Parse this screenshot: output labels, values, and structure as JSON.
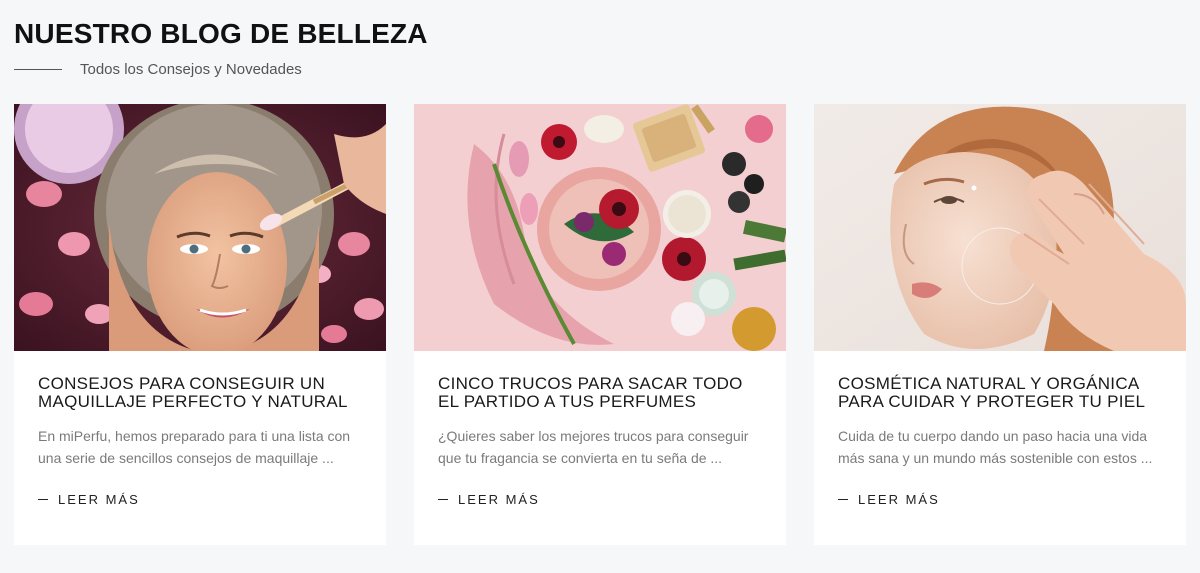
{
  "section": {
    "title": "NUESTRO BLOG DE BELLEZA",
    "subtitle": "Todos los Consejos y Novedades"
  },
  "colors": {
    "background": "#f6f7f9",
    "card": "#ffffff",
    "title_text": "#111111",
    "muted_text": "#7a7a7a"
  },
  "cards": [
    {
      "image_alt": "Mujer con toalla en la cabeza recibiendo tratamiento facial con brocha entre pétalos de rosa",
      "title": "CONSEJOS PARA CONSEGUIR UN MAQUILLAJE PERFECTO Y NATURAL",
      "excerpt": "En miPerfu, hemos preparado para ti una lista con una serie de sencillos consejos de maquillaje ...",
      "link_label": "LEER MÁS"
    },
    {
      "image_alt": "Composición de flores, piedras, jabones y toallas rosas sobre fondo rosa",
      "title": "CINCO TRUCOS PARA SACAR TODO EL PARTIDO A TUS PERFUMES",
      "excerpt": "¿Quieres saber los mejores trucos para conseguir que tu fragancia se convierta en tu seña de ...",
      "link_label": "LEER MÁS"
    },
    {
      "image_alt": "Mujer pelirroja tocando su mejilla con piel luminosa",
      "title": "COSMÉTICA NATURAL Y ORGÁNICA PARA CUIDAR Y PROTEGER TU PIEL",
      "excerpt": "Cuida de tu cuerpo dando un paso hacia una vida más sana y un mundo más sostenible con estos ...",
      "link_label": "LEER MÁS"
    }
  ]
}
